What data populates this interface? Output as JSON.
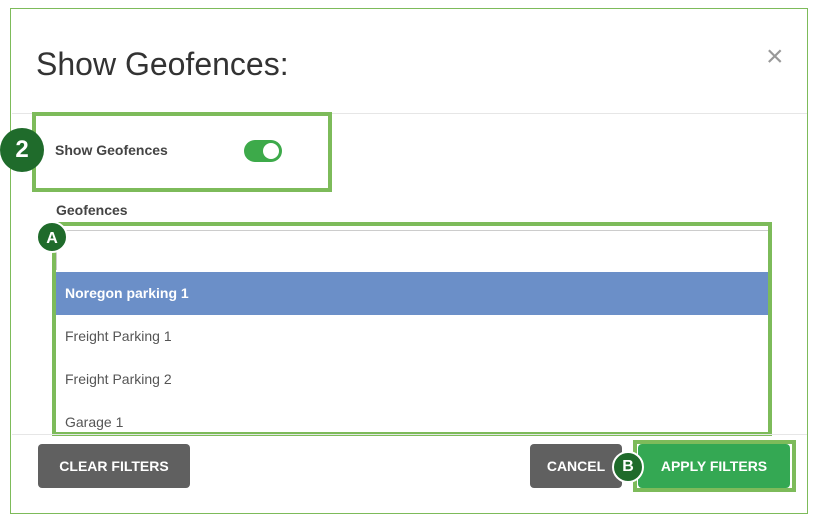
{
  "dialog": {
    "title": "Show Geofences:",
    "close_symbol": "×"
  },
  "toggle": {
    "label": "Show Geofences",
    "state": "on",
    "color": "#3daa4a"
  },
  "geofences": {
    "label": "Geofences",
    "search_value": "",
    "items": [
      {
        "label": "Noregon parking 1",
        "selected": true
      },
      {
        "label": "Freight Parking 1",
        "selected": false
      },
      {
        "label": "Freight Parking 2",
        "selected": false
      },
      {
        "label": "Garage 1",
        "selected": false
      }
    ]
  },
  "buttons": {
    "clear": "CLEAR FILTERS",
    "cancel": "CANCEL",
    "apply": "APPLY FILTERS"
  },
  "annotations": {
    "step": "2",
    "marker_a": "A",
    "marker_b": "B",
    "highlight_color": "#7dbb5a"
  }
}
